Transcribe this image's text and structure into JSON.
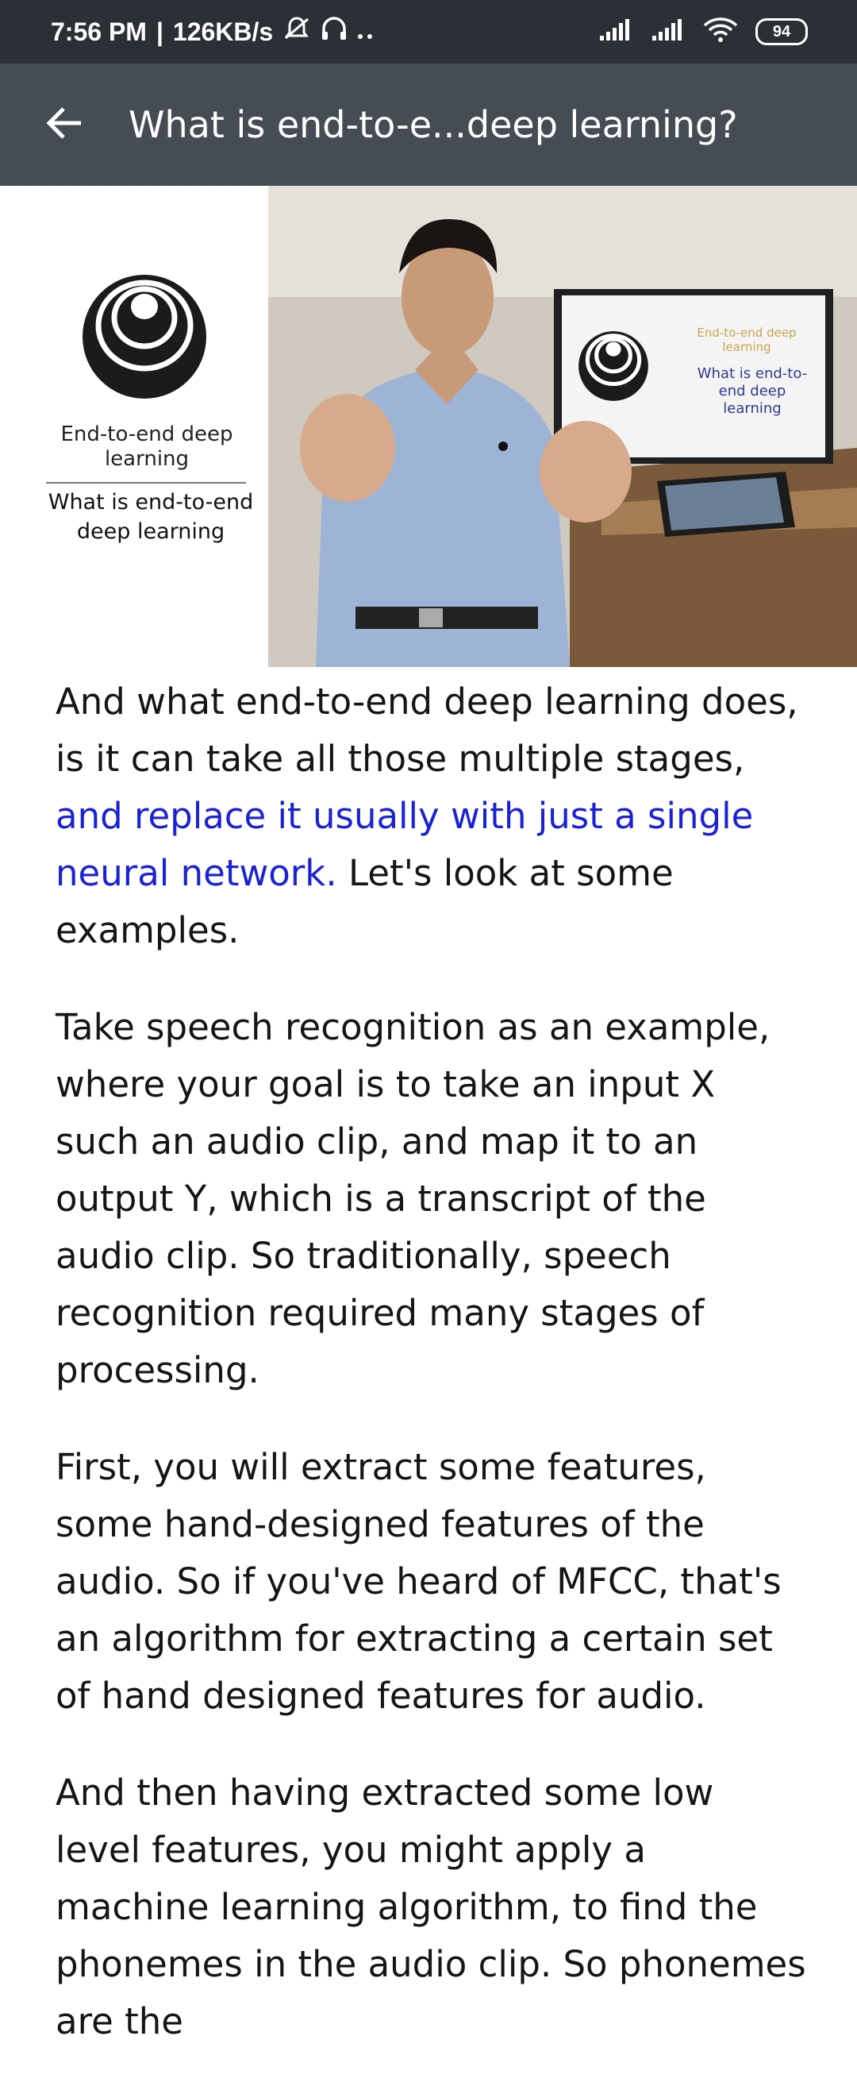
{
  "status_bar": {
    "time": "7:56 PM",
    "separator": "|",
    "network_speed": "126KB/s",
    "icons": [
      "alarm-off-icon",
      "headphones-icon",
      "more-dots-icon",
      "signal-icon",
      "signal-icon",
      "wifi-icon"
    ],
    "battery": "94"
  },
  "app_bar": {
    "back_icon": "back-arrow-icon",
    "title": "What is end-to-e...deep learning?"
  },
  "video": {
    "slide_logo": "concentric-circles-logo",
    "slide_heading": "End-to-end deep learning",
    "slide_subheading": "What is end-to-end deep learning",
    "screen_heading": "End-to-end deep learning",
    "screen_subheading": "What is end-to-end deep learning"
  },
  "transcript": {
    "paragraphs": [
      {
        "before": "And what end-to-end deep learning does, is it can take all those multiple stages, ",
        "highlight": "and replace it usually with just a single neural network.",
        "after": " Let's look at some examples."
      },
      {
        "text": "Take speech recognition as an example, where your goal is to take an input X such an audio clip, and map it to an output Y, which is a transcript of the audio clip. So traditionally, speech recognition required many stages of processing."
      },
      {
        "text": "First, you will extract some features, some hand-designed features of the audio. So if you've heard of MFCC, that's an algorithm for extracting a certain set of hand designed features for audio."
      },
      {
        "text": "And then having extracted some low level features, you might apply a machine learning algorithm, to find the phonemes in the audio clip. So phonemes are the"
      }
    ]
  },
  "colors": {
    "status_bar_bg": "#2b3036",
    "app_bar_bg": "#454c54",
    "highlight_text": "#1a22d6"
  }
}
